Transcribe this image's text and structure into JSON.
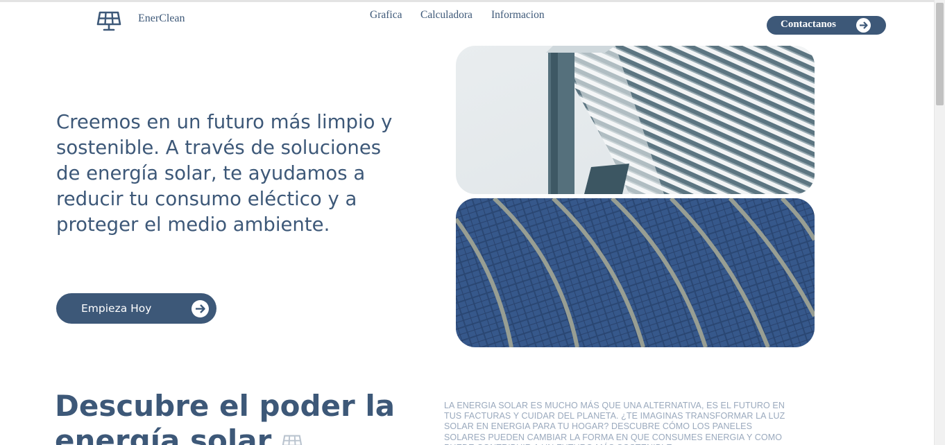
{
  "brand": {
    "name": "EnerClean",
    "icon": "solar-panel-icon"
  },
  "nav": {
    "items": [
      "Grafica",
      "Calculadora",
      "Informacion"
    ]
  },
  "header": {
    "contact_label": "Contactanos",
    "contact_icon": "arrow-right-circle-icon"
  },
  "hero": {
    "text": "Creemos en un futuro más limpio y sostenible. A través de soluciones de energía solar, te ayudamos a reducir tu consumo eléctico y a proteger el medio ambiente.",
    "cta_label": "Empieza Hoy",
    "cta_icon": "arrow-right-circle-icon"
  },
  "gallery": {
    "images": [
      "solar-structure-photo",
      "solar-panels-photo"
    ]
  },
  "section": {
    "title": "Descubre el poder la energía solar",
    "title_icon": "solar-panel-icon",
    "description": "LA ENERGIA SOLAR ES MUCHO MÁS QUE UNA ALTERNATIVA, ES EL FUTURO EN TUS FACTURAS Y CUIDAR DEL PLANETA. ¿TE IMAGINAS TRANSFORMAR LA LUZ SOLAR EN ENERGIA PARA TU HOGAR? DESCUBRE CÓMO LOS PANELES SOLARES PUEDEN CAMBIAR LA FORMA EN QUE CONSUMES ENERGIA Y COMO PUEDE CONTRIBUIR A UN FUTURO MÁS SOSTENIBLE"
  },
  "colors": {
    "primary": "#3d5878",
    "muted_text": "#9aa9bd",
    "background": "#ffffff"
  }
}
